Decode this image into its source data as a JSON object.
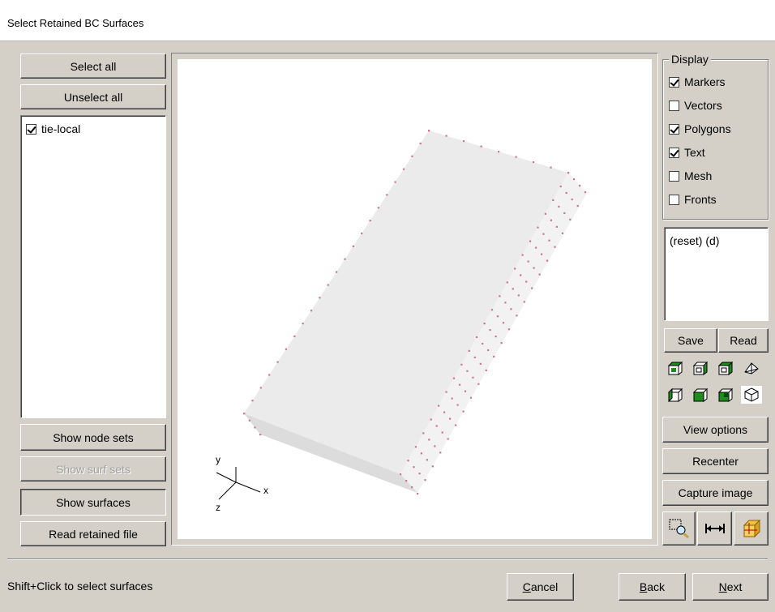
{
  "window": {
    "title": "Select Retained BC Surfaces"
  },
  "left": {
    "select_all": "Select all",
    "unselect_all": "Unselect all",
    "surfaces": [
      {
        "label": "tie-local",
        "checked": true
      }
    ],
    "show_node_sets": "Show node sets",
    "show_surf_sets": "Show surf sets",
    "show_surfaces": "Show surfaces",
    "read_retained_file": "Read retained file"
  },
  "display": {
    "legend": "Display",
    "options": [
      {
        "label": "Markers",
        "checked": true
      },
      {
        "label": "Vectors",
        "checked": false
      },
      {
        "label": "Polygons",
        "checked": true
      },
      {
        "label": "Text",
        "checked": true
      },
      {
        "label": "Mesh",
        "checked": false
      },
      {
        "label": "Fronts",
        "checked": false
      }
    ]
  },
  "views": {
    "list_text": "(reset) (d)",
    "save": "Save",
    "read": "Read"
  },
  "right_buttons": {
    "view_options": "View options",
    "recenter": "Recenter",
    "capture_image": "Capture image"
  },
  "icons": {
    "view_row1": [
      "view-cube-front-icon",
      "view-cube-side-icon",
      "view-cube-top-icon",
      "view-perspective-icon"
    ],
    "view_row2": [
      "view-cube-left-icon",
      "view-cube-back-icon",
      "view-cube-bottom-icon",
      "view-isometric-icon"
    ],
    "tools": [
      "zoom-box-icon",
      "measure-distance-icon",
      "fit-all-icon"
    ]
  },
  "axes": {
    "x": "x",
    "y": "y",
    "z": "z"
  },
  "footer": {
    "status": "Shift+Click to select surfaces",
    "cancel": "Cancel",
    "cancel_mnemonic": "C",
    "cancel_rest": "ancel",
    "back": "Back",
    "back_mnemonic": "B",
    "back_rest": "ack",
    "next": "Next",
    "next_mnemonic": "N",
    "next_rest": "ext"
  },
  "colors": {
    "face": "#d4d0c8",
    "marker": "#c87894",
    "shape_top": "#ebebeb",
    "shape_side": "#dcdcdc",
    "icon_green": "#1e8c1e"
  }
}
